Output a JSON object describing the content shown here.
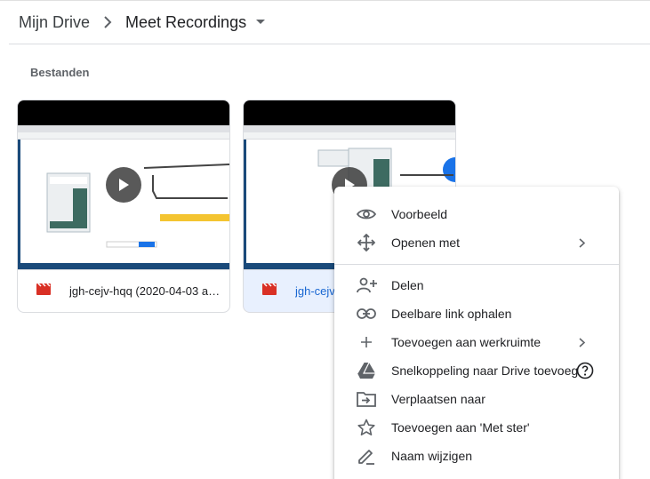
{
  "breadcrumb": {
    "root": "Mijn Drive",
    "current": "Meet Recordings"
  },
  "section": {
    "title": "Bestanden"
  },
  "files": [
    {
      "name": "jgh-cejv-hqq (2020-04-03 a…",
      "icon": "video-file-icon",
      "selected": false
    },
    {
      "name": "jgh-cejv",
      "icon": "video-file-icon",
      "selected": true
    }
  ],
  "context_menu": {
    "items": [
      {
        "label": "Voorbeeld",
        "icon": "eye-icon"
      },
      {
        "label": "Openen met",
        "icon": "move-arrows-icon",
        "submenu": true
      },
      {
        "label": "Delen",
        "icon": "add-person-icon"
      },
      {
        "label": "Deelbare link ophalen",
        "icon": "link-icon"
      },
      {
        "label": "Toevoegen aan werkruimte",
        "icon": "plus-icon",
        "submenu": true
      },
      {
        "label": "Snelkoppeling naar Drive toevoegen",
        "icon": "drive-shortcut-icon"
      },
      {
        "label": "Verplaatsen naar",
        "icon": "move-to-folder-icon"
      },
      {
        "label": "Toevoegen aan 'Met ster'",
        "icon": "star-icon"
      },
      {
        "label": "Naam wijzigen",
        "icon": "pencil-icon"
      }
    ]
  },
  "colors": {
    "accent": "#1967d2",
    "selected_bg": "#e8f0fe",
    "video_icon": "#d93025",
    "icon_gray": "#5f6368"
  }
}
